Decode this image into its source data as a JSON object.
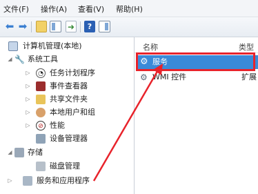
{
  "menubar": {
    "items": [
      {
        "label": "文件(F)"
      },
      {
        "label": "操作(A)"
      },
      {
        "label": "查看(V)"
      },
      {
        "label": "帮助(H)"
      }
    ]
  },
  "toolbar": {
    "buttons": [
      "back-icon",
      "forward-icon",
      "up-folder-icon",
      "show-tree-icon",
      "export-icon",
      "help-icon",
      "panel-icon"
    ]
  },
  "tree": {
    "root": {
      "label": "计算机管理(本地)"
    },
    "system_tools": {
      "label": "系统工具"
    },
    "items": [
      {
        "label": "任务计划程序",
        "icon": "clock-icon"
      },
      {
        "label": "事件查看器",
        "icon": "event-viewer-icon"
      },
      {
        "label": "共享文件夹",
        "icon": "shared-folder-icon"
      },
      {
        "label": "本地用户和组",
        "icon": "users-icon"
      },
      {
        "label": "性能",
        "icon": "performance-icon"
      },
      {
        "label": "设备管理器",
        "icon": "device-manager-icon"
      }
    ],
    "storage": {
      "label": "存储"
    },
    "disk": {
      "label": "磁盘管理"
    },
    "services_apps": {
      "label": "服务和应用程序"
    }
  },
  "list": {
    "headers": {
      "name": "名称",
      "type": "类型"
    },
    "rows": [
      {
        "name": "服务",
        "type": ""
      },
      {
        "name": "WMI 控件",
        "type": "扩展"
      }
    ]
  },
  "colors": {
    "selection": "#3a8ad9",
    "highlight_box": "#e8232b",
    "arrow": "#e8232b"
  }
}
